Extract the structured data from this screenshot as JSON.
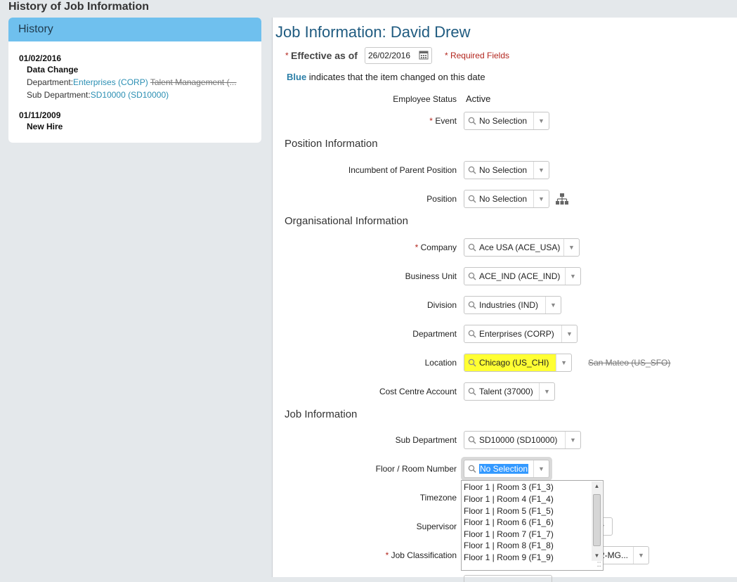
{
  "page": {
    "title": "History of Job Information"
  },
  "history": {
    "header": "History",
    "entries": [
      {
        "date": "01/02/2016",
        "event": "Data Change",
        "lines": [
          {
            "label": "Department:",
            "new_value": "Enterprises (CORP)",
            "old_value": "Talent Management (..."
          },
          {
            "label": "Sub Department:",
            "new_value": "SD10000 (SD10000)"
          }
        ]
      },
      {
        "date": "01/11/2009",
        "event": "New Hire"
      }
    ]
  },
  "main": {
    "title": "Job Information: David Drew",
    "effective_label": "Effective as of",
    "effective_date": "26/02/2016",
    "required_note": "* Required Fields",
    "blue_word": "Blue",
    "blue_note": " indicates that the item changed on this date",
    "employee_status_label": "Employee Status",
    "employee_status_value": "Active",
    "event_label": "Event",
    "event_value": "No Selection",
    "sections": {
      "position": "Position Information",
      "organisational": "Organisational Information",
      "job": "Job Information"
    },
    "position_fields": [
      {
        "label": "Incumbent of Parent Position",
        "value": "No Selection"
      },
      {
        "label": "Position",
        "value": "No Selection"
      }
    ],
    "org_fields": {
      "company": {
        "label": "Company",
        "value": "Ace USA (ACE_USA)"
      },
      "business_unit": {
        "label": "Business Unit",
        "value": "ACE_IND (ACE_IND)"
      },
      "division": {
        "label": "Division",
        "value": "Industries (IND)"
      },
      "department": {
        "label": "Department",
        "value": "Enterprises (CORP)"
      },
      "location": {
        "label": "Location",
        "value": "Chicago (US_CHI)",
        "old_value": "San Mateo (US_SFO)"
      },
      "cost_centre": {
        "label": "Cost Centre Account",
        "value": "Talent (37000)"
      }
    },
    "job_fields": {
      "sub_department": {
        "label": "Sub Department",
        "value": "SD10000 (SD10000)"
      },
      "floor_room": {
        "label": "Floor / Room Number",
        "value": "No Selection"
      },
      "timezone": {
        "label": "Timezone"
      },
      "supervisor": {
        "label": "Supervisor"
      },
      "job_classification": {
        "label": "Job Classification",
        "value_partial": "2-MG..."
      }
    },
    "floor_room_options": [
      "Floor 1 | Room 3 (F1_3)",
      "Floor 1 | Room 4 (F1_4)",
      "Floor 1 | Room 5 (F1_5)",
      "Floor 1 | Room 6 (F1_6)",
      "Floor 1 | Room 7 (F1_7)",
      "Floor 1 | Room 8 (F1_8)",
      "Floor 1 | Room 9 (F1_9)"
    ]
  },
  "colors": {
    "history_header": "#6fc0ee",
    "title_blue": "#1f5b80",
    "changed_blue": "#2b8fb3",
    "required_red": "#b3261e",
    "highlight_yellow": "#ffff33",
    "selection_blue": "#3399ff"
  },
  "icons": {
    "search": "magnifier-icon",
    "calendar": "calendar-icon",
    "org_chart": "org-chart-icon",
    "dropdown": "chevron-down-icon"
  }
}
